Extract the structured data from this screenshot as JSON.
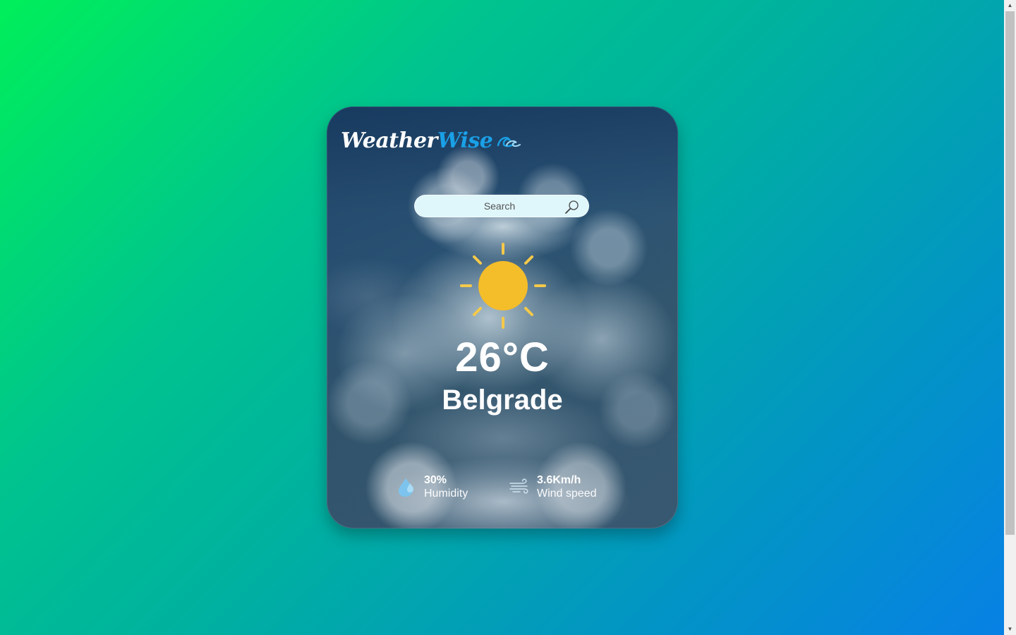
{
  "app": {
    "logo_part_1": "Weather",
    "logo_part_2": "Wise",
    "logo_icon": "wave-icon"
  },
  "search": {
    "placeholder": "Search",
    "value": "",
    "icon": "search-icon"
  },
  "weather": {
    "icon": "sun-icon",
    "temperature": "26°C",
    "city": "Belgrade"
  },
  "details": {
    "humidity": {
      "icon": "humidity-drop-icon",
      "value": "30%",
      "label": "Humidity"
    },
    "wind": {
      "icon": "wind-icon",
      "value": "3.6Km/h",
      "label": "Wind speed"
    }
  },
  "colors": {
    "background_start": "#00ef5a",
    "background_end": "#0780e6",
    "logo_accent": "#1aa0e6",
    "sun": "#f4bd2a",
    "search_bg": "#dff6fa"
  }
}
